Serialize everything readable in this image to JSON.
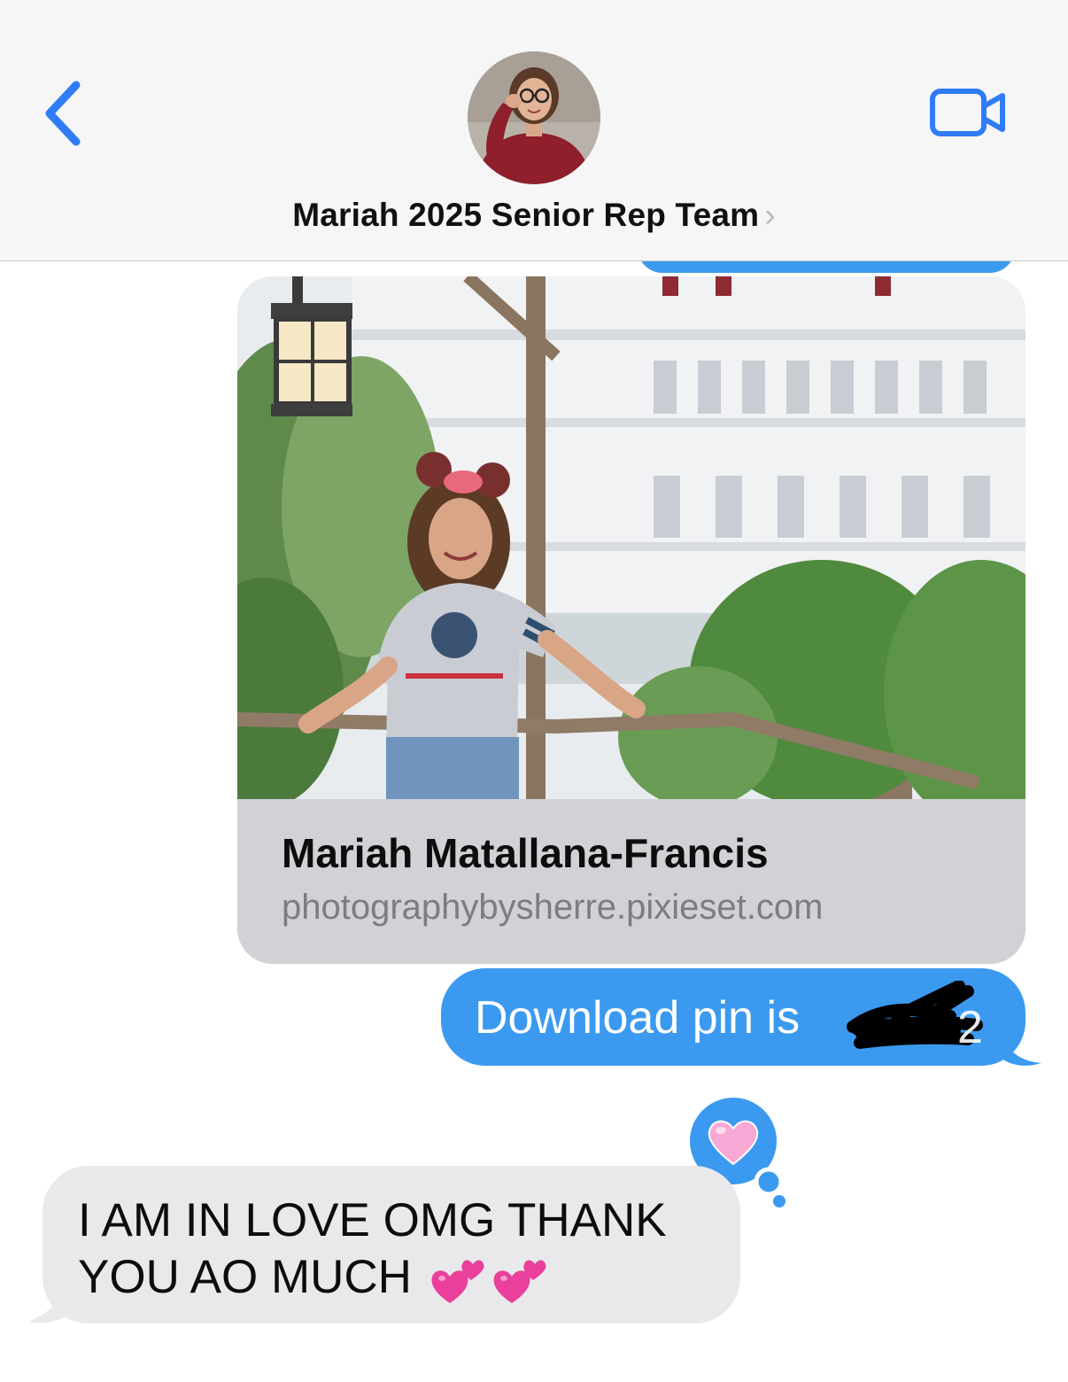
{
  "header": {
    "back_label": "Back",
    "contact_name": "Mariah 2025  Senior Rep Team",
    "chevron": "›",
    "back_icon": "chevron-left-icon",
    "video_icon": "video-camera-icon"
  },
  "messages": {
    "link_preview": {
      "title": "Mariah Matallana-Francis",
      "url": "photographybysherre.pixieset.com"
    },
    "outgoing": {
      "text": "Download pin is "
    },
    "tapback": {
      "icon": "pink-heart-icon"
    },
    "incoming": {
      "text": "I AM IN LOVE OMG THANK YOU AO MUCH "
    }
  },
  "colors": {
    "imessage_blue": "#3b9af0",
    "incoming_gray": "#e9e9eb",
    "link_card_gray": "#d1d1d6",
    "ios_tint": "#2f7cf6"
  }
}
